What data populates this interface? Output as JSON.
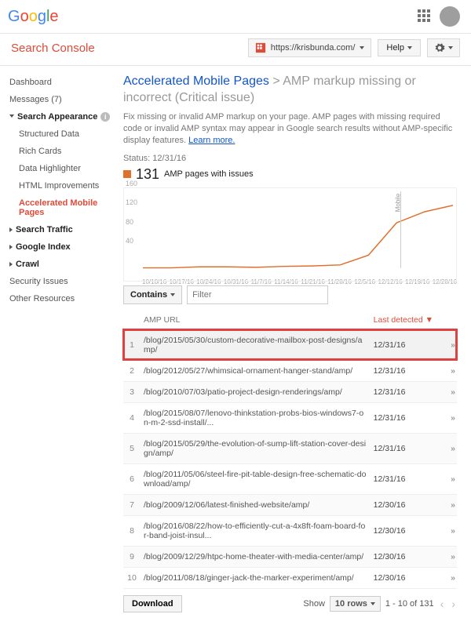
{
  "logo_letters": [
    "G",
    "o",
    "o",
    "g",
    "l",
    "e"
  ],
  "app": {
    "title": "Search Console"
  },
  "site_selector": {
    "url": "https://krisbunda.com/"
  },
  "help": {
    "label": "Help"
  },
  "sidebar": {
    "dashboard": "Dashboard",
    "messages": "Messages (7)",
    "sa_head": "Search Appearance",
    "sa_items": [
      "Structured Data",
      "Rich Cards",
      "Data Highlighter",
      "HTML Improvements",
      "Accelerated Mobile Pages"
    ],
    "search_traffic": "Search Traffic",
    "google_index": "Google Index",
    "crawl": "Crawl",
    "security": "Security Issues",
    "other": "Other Resources"
  },
  "breadcrumb": {
    "root": "Accelerated Mobile Pages",
    "sep": " > ",
    "leaf": "AMP markup missing or incorrect (Critical issue)"
  },
  "desc_text": "Fix missing or invalid AMP markup on your page. AMP pages with missing required code or invalid AMP syntax may appear in Google search results without AMP-specific display features. ",
  "desc_link": "Learn more.",
  "status_label": "Status: ",
  "status_date": "12/31/16",
  "issue_count": "131",
  "issue_label": "AMP pages with issues",
  "chart_data": {
    "type": "line",
    "title": "",
    "ylabel": "",
    "xlabel": "",
    "ylim": [
      0,
      160
    ],
    "yticks": [
      40,
      80,
      120,
      160
    ],
    "categories": [
      "10/10/16",
      "10/17/16",
      "10/24/16",
      "10/31/16",
      "11/7/16",
      "11/14/16",
      "11/21/16",
      "11/28/16",
      "12/5/16",
      "12/12/16",
      "12/19/16",
      "12/28/16"
    ],
    "values": [
      2,
      2,
      4,
      4,
      3,
      5,
      6,
      8,
      28,
      95,
      118,
      131
    ],
    "annotation": {
      "label": "Mobile",
      "x_category": "12/12/16"
    }
  },
  "filter": {
    "contains": "Contains",
    "placeholder": "Filter"
  },
  "table": {
    "headers": {
      "url": "AMP URL",
      "last": "Last detected ▼"
    },
    "rows": [
      {
        "idx": "1",
        "url": "/blog/2015/05/30/custom-decorative-mailbox-post-designs/amp/",
        "date": "12/31/16",
        "hl": true
      },
      {
        "idx": "2",
        "url": "/blog/2012/05/27/whimsical-ornament-hanger-stand/amp/",
        "date": "12/31/16"
      },
      {
        "idx": "3",
        "url": "/blog/2010/07/03/patio-project-design-renderings/amp/",
        "date": "12/31/16"
      },
      {
        "idx": "4",
        "url": "/blog/2015/08/07/lenovo-thinkstation-probs-bios-windows7-on-m-2-ssd-install/...",
        "date": "12/31/16"
      },
      {
        "idx": "5",
        "url": "/blog/2015/05/29/the-evolution-of-sump-lift-station-cover-design/amp/",
        "date": "12/31/16"
      },
      {
        "idx": "6",
        "url": "/blog/2011/05/06/steel-fire-pit-table-design-free-schematic-download/amp/",
        "date": "12/31/16"
      },
      {
        "idx": "7",
        "url": "/blog/2009/12/06/latest-finished-website/amp/",
        "date": "12/30/16"
      },
      {
        "idx": "8",
        "url": "/blog/2016/08/22/how-to-efficiently-cut-a-4x8ft-foam-board-for-band-joist-insul...",
        "date": "12/30/16"
      },
      {
        "idx": "9",
        "url": "/blog/2009/12/29/htpc-home-theater-with-media-center/amp/",
        "date": "12/30/16"
      },
      {
        "idx": "10",
        "url": "/blog/2011/08/18/ginger-jack-the-marker-experiment/amp/",
        "date": "12/30/16"
      }
    ]
  },
  "footer": {
    "download": "Download",
    "show": "Show",
    "rows": "10 rows",
    "range": "1 - 10 of 131"
  }
}
